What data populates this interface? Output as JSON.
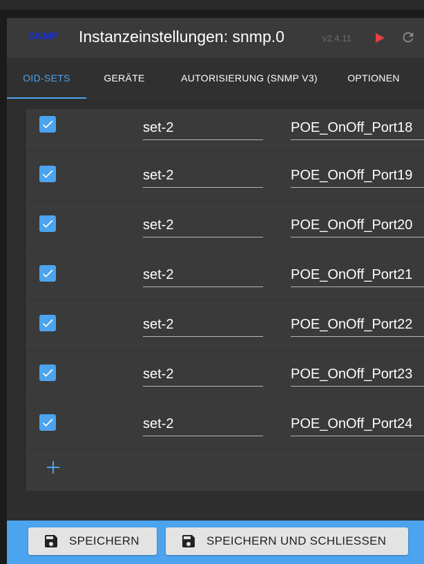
{
  "header": {
    "logo": "SNMP",
    "title": "Instanzeinstellungen: snmp.0",
    "version": "v2.4.11",
    "icons": {
      "play": "play-icon",
      "reload": "reload-icon"
    },
    "colors": {
      "logo": "#1a2fcf",
      "play": "#e84040",
      "accent": "#4ca3ee"
    }
  },
  "tabs": [
    {
      "label": "OID-SETS",
      "active": true
    },
    {
      "label": "GERÄTE",
      "active": false
    },
    {
      "label": "AUTORISIERUNG (SNMP V3)",
      "active": false
    },
    {
      "label": "OPTIONEN",
      "active": false
    }
  ],
  "rows": [
    {
      "checked": true,
      "set": "set-2",
      "name": "POE_OnOff_Port18"
    },
    {
      "checked": true,
      "set": "set-2",
      "name": "POE_OnOff_Port19"
    },
    {
      "checked": true,
      "set": "set-2",
      "name": "POE_OnOff_Port20"
    },
    {
      "checked": true,
      "set": "set-2",
      "name": "POE_OnOff_Port21"
    },
    {
      "checked": true,
      "set": "set-2",
      "name": "POE_OnOff_Port22"
    },
    {
      "checked": true,
      "set": "set-2",
      "name": "POE_OnOff_Port23"
    },
    {
      "checked": true,
      "set": "set-2",
      "name": "POE_OnOff_Port24"
    }
  ],
  "add_icon": "plus-icon",
  "footer": {
    "save_label": "SPEICHERN",
    "save_close_label": "SPEICHERN UND SCHLIESSEN",
    "icon": "floppy-disk-icon"
  }
}
